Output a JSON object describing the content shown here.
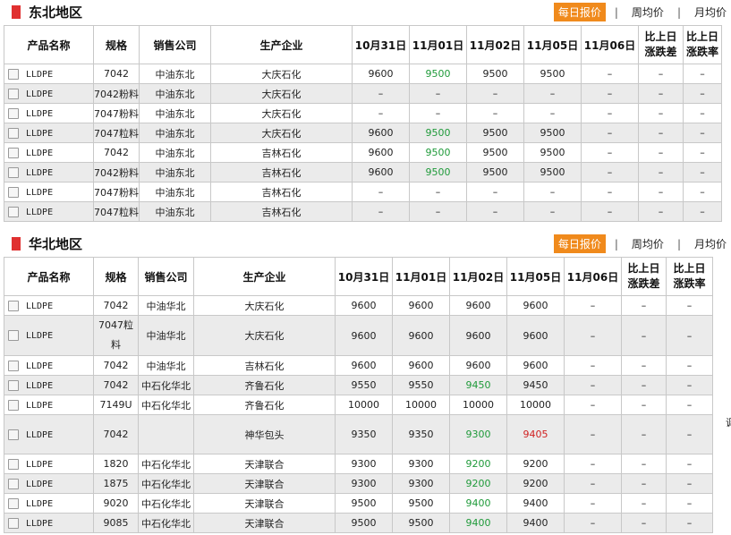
{
  "tabs": {
    "daily": "每日报价",
    "sep": "|",
    "weekly": "周均价",
    "monthly": "月均价"
  },
  "sections": [
    {
      "title": "东北地区",
      "headers": [
        "产品名称",
        "规格",
        "销售公司",
        "生产企业",
        "10月31日",
        "11月01日",
        "11月02日",
        "11月05日",
        "11月06日",
        "比上日涨跌差",
        "比上日涨跌率"
      ],
      "rows": [
        [
          "LLDPE",
          "7042",
          "中油东北",
          "大庆石化",
          "9600",
          "9500",
          "9500",
          "9500",
          "–",
          "–",
          "–"
        ],
        [
          "LLDPE",
          "7042粉料",
          "中油东北",
          "大庆石化",
          "–",
          "–",
          "–",
          "–",
          "–",
          "–",
          "–"
        ],
        [
          "LLDPE",
          "7047粉料",
          "中油东北",
          "大庆石化",
          "–",
          "–",
          "–",
          "–",
          "–",
          "–",
          "–"
        ],
        [
          "LLDPE",
          "7047粒料",
          "中油东北",
          "大庆石化",
          "9600",
          "9500",
          "9500",
          "9500",
          "–",
          "–",
          "–"
        ],
        [
          "LLDPE",
          "7042",
          "中油东北",
          "吉林石化",
          "9600",
          "9500",
          "9500",
          "9500",
          "–",
          "–",
          "–"
        ],
        [
          "LLDPE",
          "7042粉料",
          "中油东北",
          "吉林石化",
          "9600",
          "9500",
          "9500",
          "9500",
          "–",
          "–",
          "–"
        ],
        [
          "LLDPE",
          "7047粉料",
          "中油东北",
          "吉林石化",
          "–",
          "–",
          "–",
          "–",
          "–",
          "–",
          "–"
        ],
        [
          "LLDPE",
          "7047粒料",
          "中油东北",
          "吉林石化",
          "–",
          "–",
          "–",
          "–",
          "–",
          "–",
          "–"
        ]
      ],
      "colors": {
        "0": {
          "5": "up"
        },
        "3": {
          "5": "up"
        },
        "4": {
          "5": "up"
        },
        "5": {
          "5": "up"
        }
      }
    },
    {
      "title": "华北地区",
      "headers": [
        "产品名称",
        "规格",
        "销售公司",
        "生产企业",
        "10月31日",
        "11月01日",
        "11月02日",
        "11月05日",
        "11月06日",
        "比上日涨跌差",
        "比上日涨跌率"
      ],
      "rows": [
        [
          "LLDPE",
          "7042",
          "中油华北",
          "大庆石化",
          "9600",
          "9600",
          "9600",
          "9600",
          "–",
          "–",
          "–"
        ],
        [
          "LLDPE",
          "7047粒料",
          "中油华北",
          "大庆石化",
          "9600",
          "9600",
          "9600",
          "9600",
          "–",
          "–",
          "–"
        ],
        [
          "LLDPE",
          "7042",
          "中油华北",
          "吉林石化",
          "9600",
          "9600",
          "9600",
          "9600",
          "–",
          "–",
          "–"
        ],
        [
          "LLDPE",
          "7042",
          "中石化华北",
          "齐鲁石化",
          "9550",
          "9550",
          "9450",
          "9450",
          "–",
          "–",
          "–"
        ],
        [
          "LLDPE",
          "7149U",
          "中石化华北",
          "齐鲁石化",
          "10000",
          "10000",
          "10000",
          "10000",
          "–",
          "–",
          "–"
        ],
        [
          "LLDPE",
          "7042",
          "",
          "神华包头",
          "9350",
          "9350",
          "9300",
          "9405",
          "–",
          "–",
          "–"
        ],
        [
          "LLDPE",
          "1820",
          "中石化华北",
          "天津联合",
          "9300",
          "9300",
          "9200",
          "9200",
          "–",
          "–",
          "–"
        ],
        [
          "LLDPE",
          "1875",
          "中石化华北",
          "天津联合",
          "9300",
          "9300",
          "9200",
          "9200",
          "–",
          "–",
          "–"
        ],
        [
          "LLDPE",
          "9020",
          "中石化华北",
          "天津联合",
          "9500",
          "9500",
          "9400",
          "9400",
          "–",
          "–",
          "–"
        ],
        [
          "LLDPE",
          "9085",
          "中石化华北",
          "天津联合",
          "9500",
          "9500",
          "9400",
          "9400",
          "–",
          "–",
          "–"
        ]
      ],
      "colors": {
        "3": {
          "6": "up"
        },
        "5": {
          "6": "up",
          "7": "down"
        },
        "6": {
          "6": "up"
        },
        "7": {
          "6": "up"
        },
        "8": {
          "6": "up"
        },
        "9": {
          "6": "up"
        }
      },
      "edge_glyph": "调"
    }
  ]
}
